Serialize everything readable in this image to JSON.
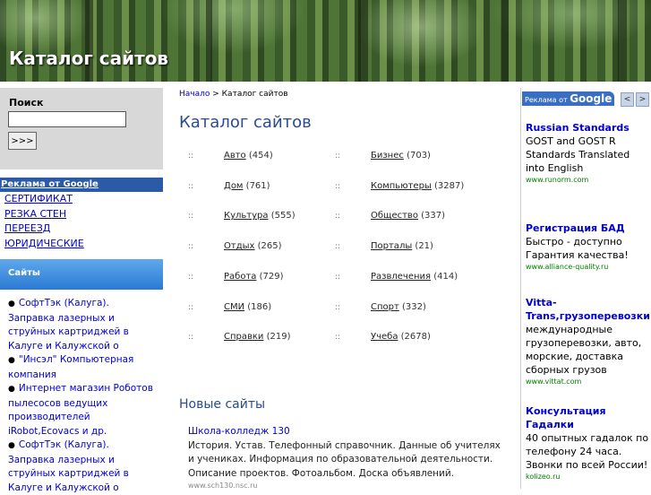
{
  "header": {
    "title": "Каталог сайтов"
  },
  "search": {
    "label": "Поиск",
    "value": "",
    "button": ">>>"
  },
  "ads_left": {
    "title": "Реклама от Google",
    "links": [
      "СЕРТИФИКАТ",
      "РЕЗКА СТЕН",
      "ПЕРЕЕЗД",
      "ЮРИДИЧЕСКИЕ"
    ]
  },
  "sites": {
    "title": "Сайты",
    "items": [
      "СофтТэк (Калуга). Заправка лазерных и струйных картриджей в Калуге и Калужской о",
      "\"Инсэл\" Компьютерная компания",
      "Интернет магазин Роботов пылесосов ведущих производителей iRobot,Ecovacs и др.",
      "СофтТэк (Калуга). Заправка лазерных и струйных картриджей в Калуге и Калужской о"
    ]
  },
  "breadcrumb": {
    "home": "Начало",
    "separator": ">",
    "current": "Каталог сайтов"
  },
  "main": {
    "title": "Каталог сайтов",
    "bullet": "::",
    "categories": [
      {
        "name": "Авто",
        "count": "(454)"
      },
      {
        "name": "Бизнес",
        "count": "(703)"
      },
      {
        "name": "Дом",
        "count": "(761)"
      },
      {
        "name": "Компьютеры",
        "count": "(3287)"
      },
      {
        "name": "Культура",
        "count": "(555)"
      },
      {
        "name": "Общество",
        "count": "(337)"
      },
      {
        "name": "Отдых",
        "count": "(265)"
      },
      {
        "name": "Порталы",
        "count": "(21)"
      },
      {
        "name": "Работа",
        "count": "(729)"
      },
      {
        "name": "Развлечения",
        "count": "(414)"
      },
      {
        "name": "СМИ",
        "count": "(186)"
      },
      {
        "name": "Спорт",
        "count": "(332)"
      },
      {
        "name": "Справки",
        "count": "(219)"
      },
      {
        "name": "Учеба",
        "count": "(2678)"
      }
    ],
    "new_sites_title": "Новые сайты",
    "new_site": {
      "name": "Школа-колледж 130",
      "description": "История. Устав. Телефонный справочник. Данные об учителях и учениках. Информация по образовательной деятельности. Описание проектов. Фотоальбом. Доска объявлений.",
      "url": "www.sch130.nsc.ru"
    }
  },
  "ads_right": {
    "label_prefix": "Реклама от",
    "label_brand": "Google",
    "prev": "<",
    "next": ">",
    "items": [
      {
        "title": "Russian Standards",
        "text": "GOST and GOST R Standards Translated into English",
        "url": "www.runorm.com"
      },
      {
        "title": "Регистрация БАД",
        "text": "Быстро - доступно Гарантия качества!",
        "url": "www.alliance-quality.ru"
      },
      {
        "title": "Vitta-Trans,грузоперевозки",
        "text": "международные грузоперевозки, авто, морские, доставка сборных грузов",
        "url": "www.vittat.com"
      },
      {
        "title": "Консультация Гадалки",
        "text": "40 опытных гадалок по телефону 24 часа. Звонки по всей России!",
        "url": "kolizeo.ru"
      }
    ]
  },
  "colors": {
    "accent": "#2a4b8d",
    "link": "#0000cc",
    "ad_header": "#2b5aa6",
    "sites_header": "#3a8ae0"
  }
}
